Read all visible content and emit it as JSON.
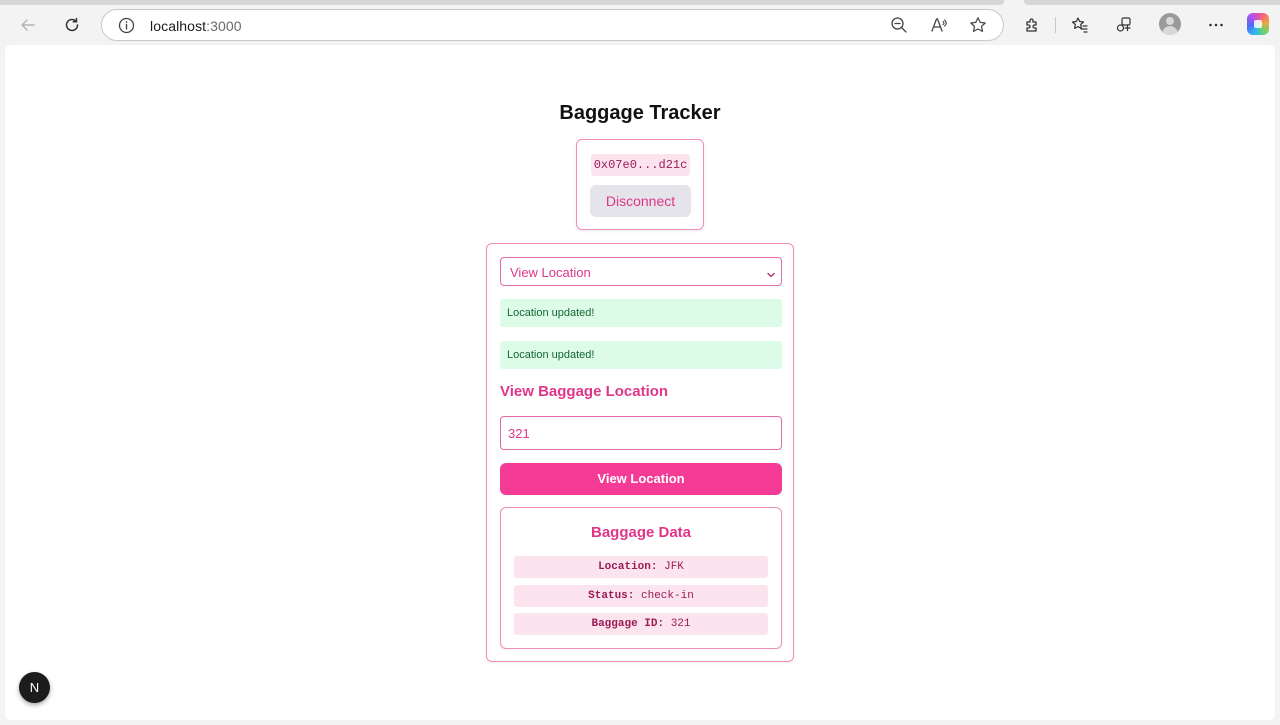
{
  "browser": {
    "url_host": "localhost",
    "url_port": ":3000",
    "icons": [
      "back-icon",
      "reload-icon",
      "info-icon",
      "zoom-out-icon",
      "read-aloud-icon",
      "favorite-star-icon",
      "extensions-icon",
      "favorites-icon",
      "collections-icon",
      "profile-avatar",
      "more-icon",
      "copilot-icon"
    ]
  },
  "page": {
    "title": "Baggage Tracker",
    "wallet": {
      "address": "0x07e0...d21c",
      "disconnect_label": "Disconnect"
    },
    "action_select": {
      "selected": "View Location"
    },
    "alerts": [
      "Location updated!",
      "Location updated!"
    ],
    "section_title": "View Baggage Location",
    "baggage_id_input": {
      "value": "321"
    },
    "view_button_label": "View Location",
    "baggage_data": {
      "title": "Baggage Data",
      "rows": [
        {
          "key": "Location:",
          "value": "JFK"
        },
        {
          "key": "Status:",
          "value": "check-in"
        },
        {
          "key": "Baggage ID:",
          "value": "321"
        }
      ]
    },
    "dev_badge_letter": "N"
  },
  "colors": {
    "accent": "#f43c96",
    "accent_text": "#e0368a",
    "border": "#f38dbb",
    "chip_bg": "#fce4ef",
    "success_bg": "#dcfce7",
    "success_text": "#166534"
  }
}
